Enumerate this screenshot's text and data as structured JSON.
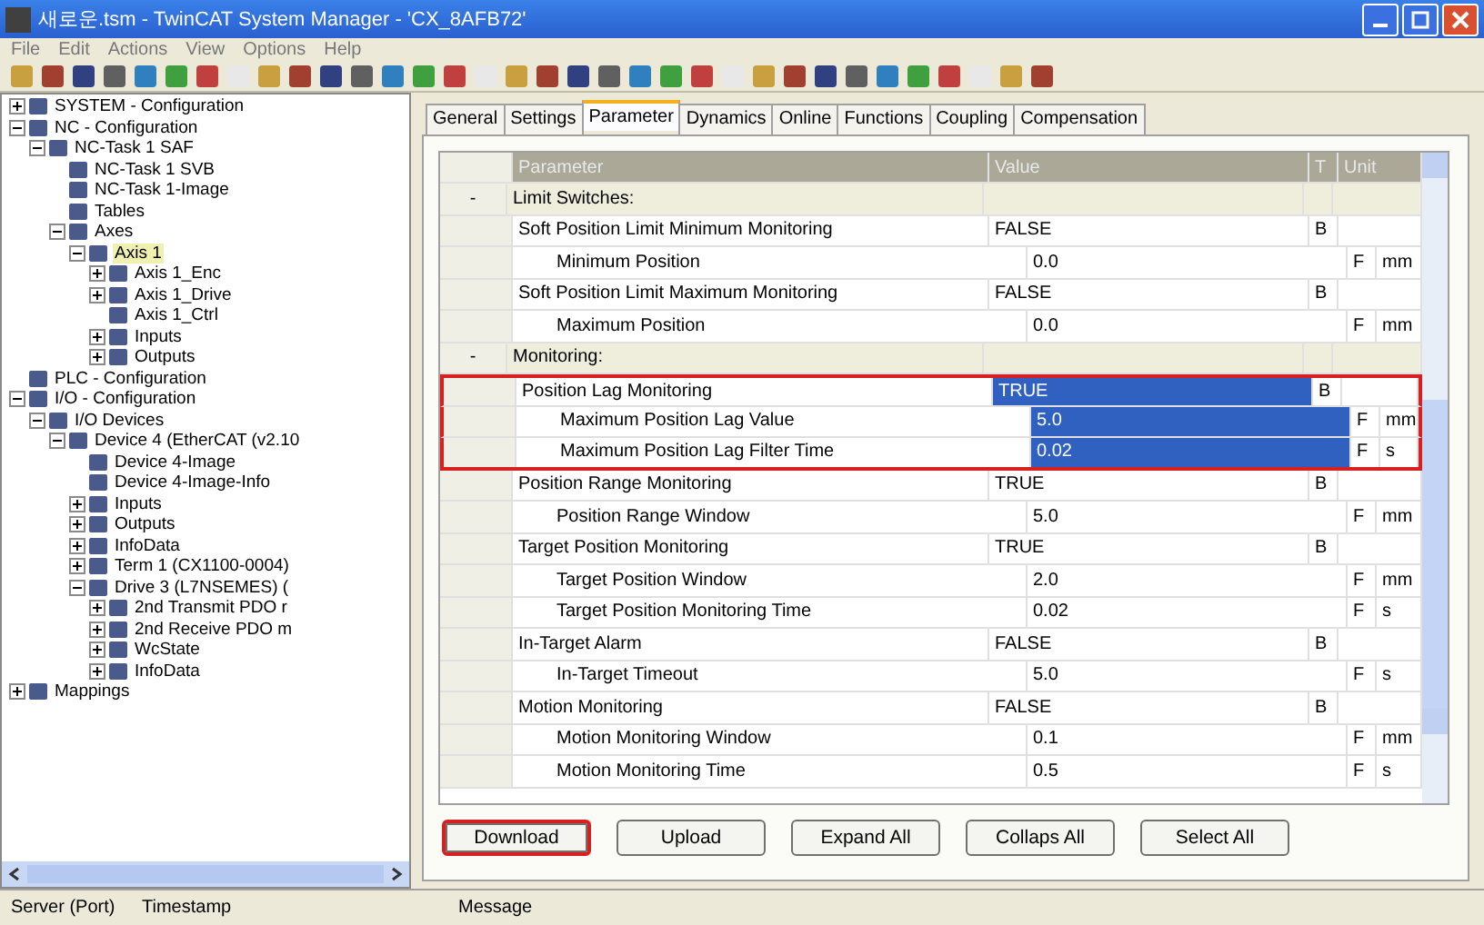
{
  "window": {
    "title": "새로운.tsm - TwinCAT System Manager - 'CX_8AFB72'"
  },
  "menu": [
    "File",
    "Edit",
    "Actions",
    "View",
    "Options",
    "Help"
  ],
  "tree": [
    {
      "label": "SYSTEM - Configuration",
      "expanded": false,
      "selected": false
    },
    {
      "label": "NC - Configuration",
      "expanded": true,
      "selected": false,
      "children": [
        {
          "label": "NC-Task 1 SAF",
          "expanded": true,
          "selected": false,
          "children": [
            {
              "label": "NC-Task 1 SVB",
              "selected": false
            },
            {
              "label": "NC-Task 1-Image",
              "selected": false
            },
            {
              "label": "Tables",
              "selected": false
            },
            {
              "label": "Axes",
              "expanded": true,
              "selected": false,
              "children": [
                {
                  "label": "Axis 1",
                  "expanded": true,
                  "selected": true,
                  "children": [
                    {
                      "label": "Axis 1_Enc",
                      "expanded": false,
                      "selected": false
                    },
                    {
                      "label": "Axis 1_Drive",
                      "expanded": false,
                      "selected": false
                    },
                    {
                      "label": "Axis 1_Ctrl",
                      "selected": false
                    },
                    {
                      "label": "Inputs",
                      "expanded": false,
                      "selected": false
                    },
                    {
                      "label": "Outputs",
                      "expanded": false,
                      "selected": false
                    }
                  ]
                }
              ]
            }
          ]
        }
      ]
    },
    {
      "label": "PLC - Configuration",
      "selected": false
    },
    {
      "label": "I/O - Configuration",
      "expanded": true,
      "selected": false,
      "children": [
        {
          "label": "I/O Devices",
          "expanded": true,
          "selected": false,
          "children": [
            {
              "label": "Device 4 (EtherCAT (v2.10",
              "expanded": true,
              "selected": false,
              "children": [
                {
                  "label": "Device 4-Image",
                  "selected": false
                },
                {
                  "label": "Device 4-Image-Info",
                  "selected": false
                },
                {
                  "label": "Inputs",
                  "expanded": false,
                  "selected": false
                },
                {
                  "label": "Outputs",
                  "expanded": false,
                  "selected": false
                },
                {
                  "label": "InfoData",
                  "expanded": false,
                  "selected": false
                },
                {
                  "label": "Term 1 (CX1100-0004)",
                  "expanded": false,
                  "selected": false
                },
                {
                  "label": "Drive 3 (L7NSEMES) (",
                  "expanded": true,
                  "selected": false,
                  "children": [
                    {
                      "label": "2nd Transmit PDO r",
                      "expanded": false,
                      "selected": false
                    },
                    {
                      "label": "2nd Receive PDO m",
                      "expanded": false,
                      "selected": false
                    },
                    {
                      "label": "WcState",
                      "expanded": false,
                      "selected": false
                    },
                    {
                      "label": "InfoData",
                      "expanded": false,
                      "selected": false
                    }
                  ]
                }
              ]
            }
          ]
        }
      ]
    },
    {
      "label": "Mappings",
      "expanded": false,
      "selected": false
    }
  ],
  "tabs": [
    {
      "label": "General",
      "selected": false
    },
    {
      "label": "Settings",
      "selected": false
    },
    {
      "label": "Parameter",
      "selected": true
    },
    {
      "label": "Dynamics",
      "selected": false
    },
    {
      "label": "Online",
      "selected": false
    },
    {
      "label": "Functions",
      "selected": false
    },
    {
      "label": "Coupling",
      "selected": false
    },
    {
      "label": "Compensation",
      "selected": false
    }
  ],
  "table": {
    "columns": [
      "Parameter",
      "Value",
      "T",
      "Unit"
    ],
    "rows": [
      {
        "kind": "group",
        "name": "Limit Switches:",
        "expander": "-"
      },
      {
        "kind": "param",
        "indent": false,
        "name": "Soft Position Limit Minimum Monitoring",
        "value": "FALSE",
        "type": "B",
        "unit": "",
        "selected": false,
        "highlighted": false
      },
      {
        "kind": "param",
        "indent": true,
        "name": "Minimum Position",
        "value": "0.0",
        "type": "F",
        "unit": "mm",
        "selected": false,
        "highlighted": false
      },
      {
        "kind": "param",
        "indent": false,
        "name": "Soft Position Limit Maximum Monitoring",
        "value": "FALSE",
        "type": "B",
        "unit": "",
        "selected": false,
        "highlighted": false
      },
      {
        "kind": "param",
        "indent": true,
        "name": "Maximum Position",
        "value": "0.0",
        "type": "F",
        "unit": "mm",
        "selected": false,
        "highlighted": false
      },
      {
        "kind": "group",
        "name": "Monitoring:",
        "expander": "-"
      },
      {
        "kind": "param",
        "indent": false,
        "name": "Position Lag Monitoring",
        "value": "TRUE",
        "type": "B",
        "unit": "",
        "selected": true,
        "highlighted": true
      },
      {
        "kind": "param",
        "indent": true,
        "name": "Maximum Position Lag Value",
        "value": "5.0",
        "type": "F",
        "unit": "mm",
        "selected": true,
        "highlighted": true
      },
      {
        "kind": "param",
        "indent": true,
        "name": "Maximum Position Lag Filter Time",
        "value": "0.02",
        "type": "F",
        "unit": "s",
        "selected": true,
        "highlighted": true
      },
      {
        "kind": "param",
        "indent": false,
        "name": "Position Range Monitoring",
        "value": "TRUE",
        "type": "B",
        "unit": "",
        "selected": false,
        "highlighted": false
      },
      {
        "kind": "param",
        "indent": true,
        "name": "Position Range Window",
        "value": "5.0",
        "type": "F",
        "unit": "mm",
        "selected": false,
        "highlighted": false
      },
      {
        "kind": "param",
        "indent": false,
        "name": "Target Position Monitoring",
        "value": "TRUE",
        "type": "B",
        "unit": "",
        "selected": false,
        "highlighted": false
      },
      {
        "kind": "param",
        "indent": true,
        "name": "Target Position Window",
        "value": "2.0",
        "type": "F",
        "unit": "mm",
        "selected": false,
        "highlighted": false
      },
      {
        "kind": "param",
        "indent": true,
        "name": "Target Position Monitoring Time",
        "value": "0.02",
        "type": "F",
        "unit": "s",
        "selected": false,
        "highlighted": false
      },
      {
        "kind": "param",
        "indent": false,
        "name": "In-Target Alarm",
        "value": "FALSE",
        "type": "B",
        "unit": "",
        "selected": false,
        "highlighted": false
      },
      {
        "kind": "param",
        "indent": true,
        "name": "In-Target Timeout",
        "value": "5.0",
        "type": "F",
        "unit": "s",
        "selected": false,
        "highlighted": false
      },
      {
        "kind": "param",
        "indent": false,
        "name": "Motion Monitoring",
        "value": "FALSE",
        "type": "B",
        "unit": "",
        "selected": false,
        "highlighted": false
      },
      {
        "kind": "param",
        "indent": true,
        "name": "Motion Monitoring Window",
        "value": "0.1",
        "type": "F",
        "unit": "mm",
        "selected": false,
        "highlighted": false
      },
      {
        "kind": "param",
        "indent": true,
        "name": "Motion Monitoring Time",
        "value": "0.5",
        "type": "F",
        "unit": "s",
        "selected": false,
        "highlighted": false
      }
    ]
  },
  "buttons": [
    {
      "label": "Download",
      "highlighted": true
    },
    {
      "label": "Upload",
      "highlighted": false
    },
    {
      "label": "Expand All",
      "highlighted": false
    },
    {
      "label": "Collaps All",
      "highlighted": false
    },
    {
      "label": "Select All",
      "highlighted": false
    }
  ],
  "status_bar": [
    "Server (Port)",
    "Timestamp",
    "Message"
  ]
}
